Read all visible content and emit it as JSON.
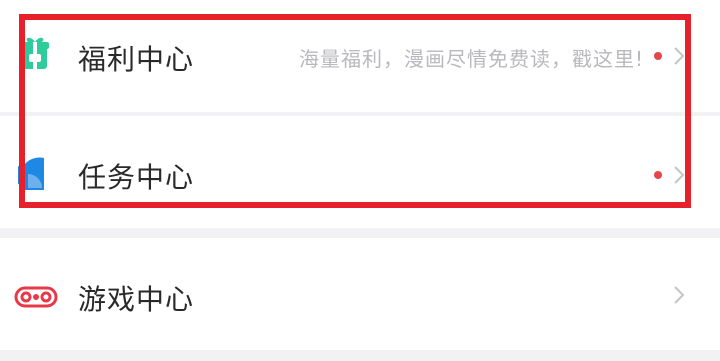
{
  "menu": {
    "items": [
      {
        "label": "福利中心",
        "description": "海量福利，漫画尽情免费读，戳这里!",
        "has_badge": true,
        "icon": "gift-icon"
      },
      {
        "label": "任务中心",
        "description": "",
        "has_badge": true,
        "icon": "task-pie-icon"
      },
      {
        "label": "游戏中心",
        "description": "",
        "has_badge": false,
        "icon": "gamepad-icon"
      }
    ]
  },
  "colors": {
    "badge": "#e6454a",
    "highlight_border": "#e8202c",
    "gift_icon": "#2ecc9a",
    "task_icon": "#1e88e5",
    "game_icon": "#e8394a",
    "chevron": "#c4c4c8",
    "label_text": "#2a2a2a",
    "desc_text": "#b9b9bd"
  }
}
